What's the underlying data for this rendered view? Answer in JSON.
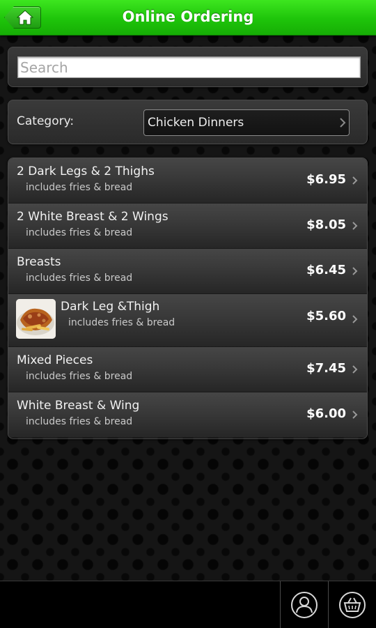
{
  "header": {
    "title": "Online Ordering",
    "home_icon": "home-icon",
    "accent_color": "#22c40e"
  },
  "search": {
    "placeholder": "Search",
    "value": ""
  },
  "category": {
    "label": "Category:",
    "selected": "Chicken Dinners"
  },
  "menu": {
    "items": [
      {
        "name": "2 Dark Legs & 2 Thighs",
        "description": "includes fries & bread",
        "price": "$6.95",
        "has_image": false
      },
      {
        "name": "2 White Breast & 2 Wings",
        "description": "includes fries & bread",
        "price": "$8.05",
        "has_image": false
      },
      {
        "name": "Breasts",
        "description": "includes fries & bread",
        "price": "$6.45",
        "has_image": false
      },
      {
        "name": "Dark Leg &Thigh",
        "description": "includes fries & bread",
        "price": "$5.60",
        "has_image": true,
        "image_icon": "food-thumbnail"
      },
      {
        "name": "Mixed Pieces",
        "description": "includes fries & bread",
        "price": "$7.45",
        "has_image": false
      },
      {
        "name": "White Breast & Wing",
        "description": "includes fries & bread",
        "price": "$6.00",
        "has_image": false
      }
    ]
  },
  "bottom_bar": {
    "account_icon": "account-icon",
    "cart_icon": "shopping-basket-icon"
  }
}
